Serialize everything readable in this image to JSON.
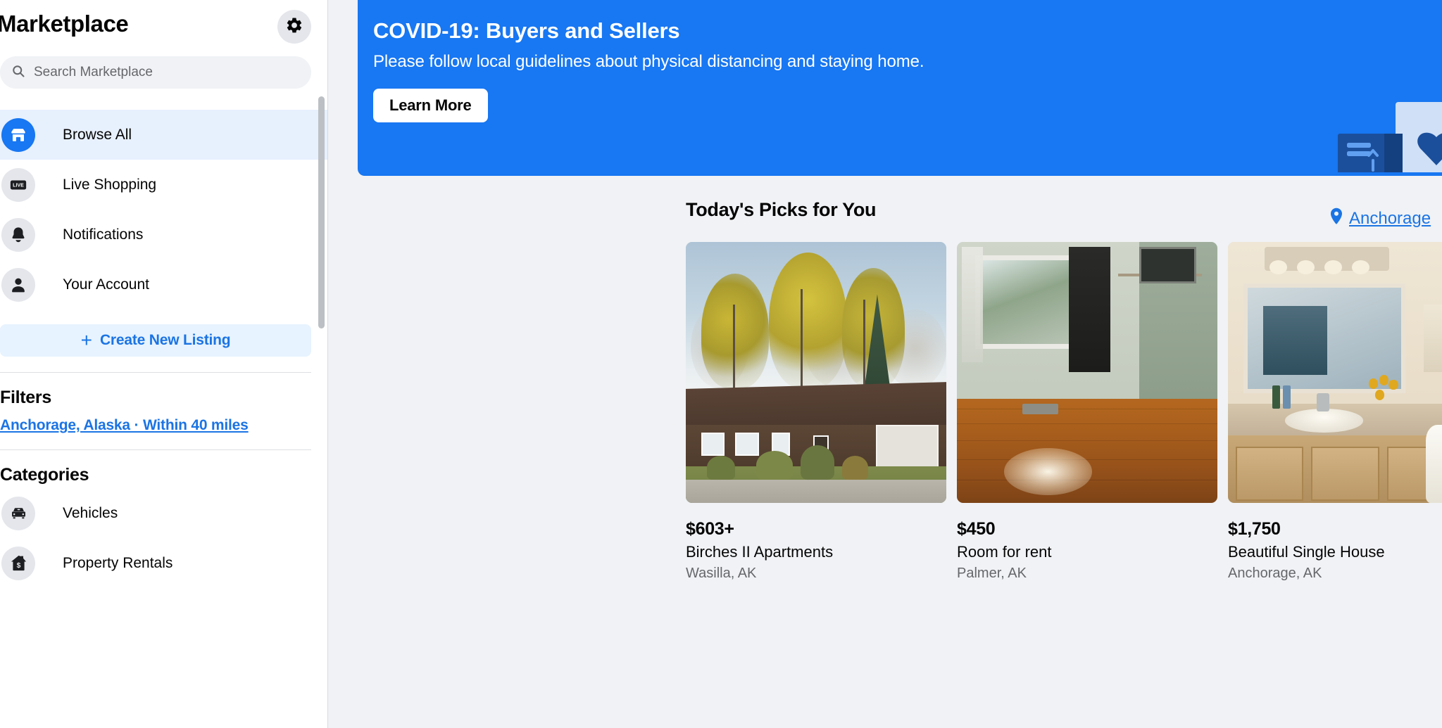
{
  "sidebar": {
    "title": "Marketplace",
    "gear_icon": "gear-icon",
    "search": {
      "icon": "search-icon",
      "placeholder": "Search Marketplace",
      "value": ""
    },
    "nav_items": [
      {
        "label": "Browse All",
        "icon": "storefront-icon",
        "active": true
      },
      {
        "label": "Live Shopping",
        "icon": "live-badge-icon",
        "active": false
      },
      {
        "label": "Notifications",
        "icon": "bell-icon",
        "active": false
      },
      {
        "label": "Your Account",
        "icon": "person-icon",
        "active": false
      }
    ],
    "create_listing": {
      "plus": "+",
      "label": "Create New Listing"
    },
    "filters": {
      "heading": "Filters",
      "location_filter": "Anchorage, Alaska · Within 40 miles"
    },
    "categories": {
      "heading": "Categories",
      "items": [
        {
          "label": "Vehicles",
          "icon": "car-icon"
        },
        {
          "label": "Property Rentals",
          "icon": "house-dollar-icon"
        }
      ]
    }
  },
  "banner": {
    "title": "COVID-19: Buyers and Sellers",
    "subtitle": "Please follow local guidelines about physical distancing and staying home.",
    "button_label": "Learn More",
    "background_color": "#1877f2",
    "art": "package-and-favorite-card-illustration"
  },
  "picks": {
    "title": "Today's Picks for You",
    "location_label": "Anchorage",
    "location_icon": "map-pin-icon",
    "cards": [
      {
        "price": "$603+",
        "name": "Birches II Apartments",
        "location": "Wasilla, AK",
        "photo": "brown-house-with-autumn-trees"
      },
      {
        "price": "$450",
        "name": "Room for rent",
        "location": "Palmer, AK",
        "photo": "empty-room-with-wood-floor"
      },
      {
        "price": "$1,750",
        "name": "Beautiful Single House",
        "location": "Anchorage, AK",
        "photo": "bathroom-with-mirror-and-vanity"
      }
    ]
  },
  "colors": {
    "accent": "#1877f2",
    "link": "#1b74e4",
    "active_row": "#e7f0fd",
    "page_bg": "#f0f2f5",
    "muted_text": "#65676b"
  }
}
